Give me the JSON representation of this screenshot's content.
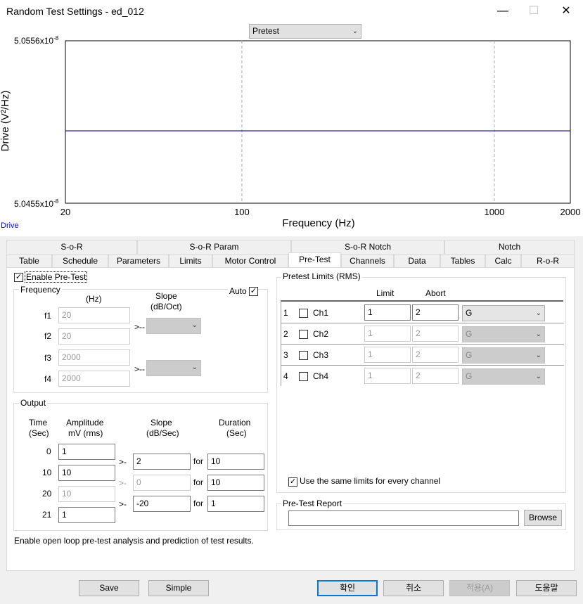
{
  "window": {
    "title": "Random Test Settings - ed_012",
    "min": "—",
    "max": "☐",
    "close": "✕"
  },
  "chart": {
    "dropdown": "Pretest",
    "ytop": "5.0556x10",
    "ybottom": "5.0455x10",
    "exp": "-8",
    "ylabel": "Drive (V²/Hz)",
    "xlabel": "Frequency (Hz)",
    "x20": "20",
    "x100": "100",
    "x1000": "1000",
    "x2000": "2000",
    "legend": "Drive"
  },
  "chart_data": {
    "type": "line",
    "title": "",
    "xlabel": "Frequency (Hz)",
    "ylabel": "Drive (V²/Hz)",
    "x_scale": "log",
    "xlim": [
      20,
      2000
    ],
    "ylim": [
      5.0455e-08,
      5.0556e-08
    ],
    "grid": "x-dashed",
    "series": [
      {
        "name": "Drive",
        "x": [
          20,
          2000
        ],
        "y": [
          5.05e-08,
          5.05e-08
        ]
      }
    ]
  },
  "tabs_top": [
    "S-o-R",
    "S-o-R Param",
    "S-o-R Notch",
    "Notch"
  ],
  "tabs_bottom": [
    "Table",
    "Schedule",
    "Parameters",
    "Limits",
    "Motor Control",
    "Pre-Test",
    "Channels",
    "Data",
    "Tables",
    "Calc",
    "R-o-R"
  ],
  "pretest": {
    "enable": "Enable Pre-Test",
    "freq": {
      "title": "Frequency",
      "hz": "(Hz)",
      "slope": "Slope",
      "slope_unit": "(dB/Oct)",
      "auto": "Auto",
      "f1": "f1",
      "f2": "f2",
      "f3": "f3",
      "f4": "f4",
      "v1": "20",
      "v2": "20",
      "v3": "2000",
      "v4": "2000",
      "arrow": ">--"
    },
    "output": {
      "title": "Output",
      "time": "Time",
      "time_u": "(Sec)",
      "amp": "Amplitude",
      "amp_u": "mV (rms)",
      "slope": "Slope",
      "slope_u": "(dB/Sec)",
      "dur": "Duration",
      "dur_u": "(Sec)",
      "arrow": ">-",
      "for": "for",
      "rows": [
        {
          "t": "0",
          "a": "1"
        },
        {
          "t": "10",
          "a": "10",
          "s": "2",
          "d": "10"
        },
        {
          "t": "20",
          "a": "10",
          "s": "0",
          "d": "10"
        },
        {
          "t": "21",
          "a": "1",
          "s": "-20",
          "d": "1"
        }
      ]
    },
    "hint": "Enable open loop pre-test analysis and prediction of test results.",
    "limits": {
      "title": "Pretest Limits (RMS)",
      "limit": "Limit",
      "abort": "Abort",
      "same": "Use the same limits for every channel",
      "rows": [
        {
          "n": "1",
          "ch": "Ch1",
          "l": "1",
          "a": "2",
          "u": "G"
        },
        {
          "n": "2",
          "ch": "Ch2",
          "l": "1",
          "a": "2",
          "u": "G"
        },
        {
          "n": "3",
          "ch": "Ch3",
          "l": "1",
          "a": "2",
          "u": "G"
        },
        {
          "n": "4",
          "ch": "Ch4",
          "l": "1",
          "a": "2",
          "u": "G"
        }
      ]
    },
    "report": {
      "title": "Pre-Test Report",
      "browse": "Browse"
    }
  },
  "buttons": {
    "save": "Save",
    "simple": "Simple",
    "ok": "확인",
    "cancel": "취소",
    "apply": "적용(A)",
    "help": "도움말"
  }
}
